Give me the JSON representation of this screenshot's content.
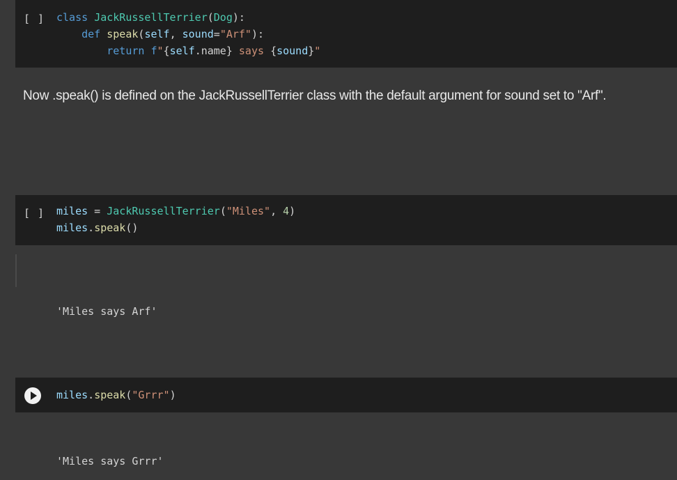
{
  "cells": [
    {
      "run_indicator": "[ ]",
      "code_lines": [
        "class JackRussellTerrier(Dog):",
        "    def speak(self, sound=\"Arf\"):",
        "        return f\"{self.name} says {sound}\""
      ]
    },
    {
      "markdown_text": "Now .speak() is defined on the JackRussellTerrier class with the default argument for sound set to \"Arf\"."
    },
    {
      "run_indicator": "[ ]",
      "code_lines": [
        "miles = JackRussellTerrier(\"Miles\", 4)",
        "miles.speak()"
      ],
      "output": "'Miles says Arf'"
    },
    {
      "run_button_icon": "play-icon",
      "code_lines": [
        "miles.speak(\"Grrr\")"
      ],
      "output": "'Miles says Grrr'"
    }
  ],
  "colors": {
    "background": "#383838",
    "code_background": "#1e1e1e",
    "keyword": "#569cd6",
    "class_name": "#4ec9b0",
    "function": "#dcdcaa",
    "string": "#ce9178",
    "number": "#b5cea8"
  }
}
